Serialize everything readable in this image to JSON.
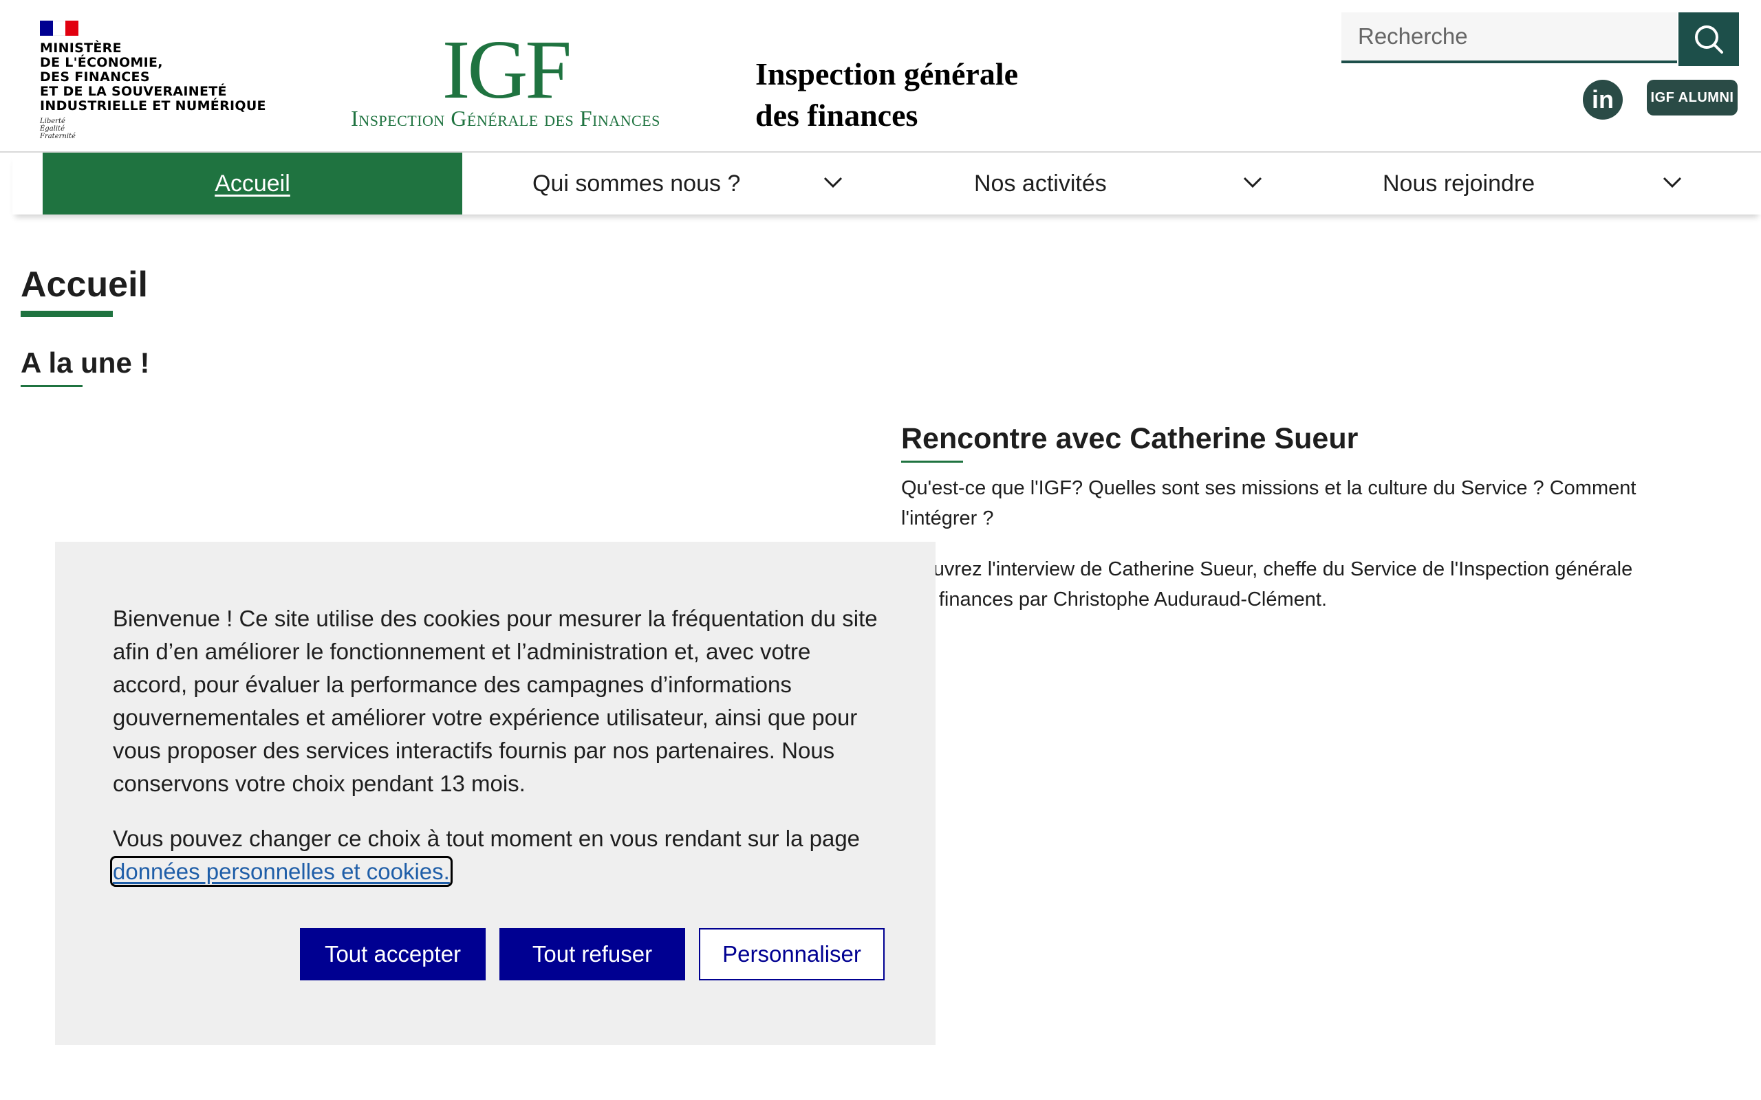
{
  "header": {
    "ministry_lines": [
      "MINISTÈRE",
      "DE L'ÉCONOMIE,",
      "DES FINANCES",
      "ET DE LA SOUVERAINETÉ",
      "INDUSTRIELLE ET NUMÉRIQUE"
    ],
    "motto_lines": [
      "Liberté",
      "Égalité",
      "Fraternité"
    ],
    "logo_text": "IGF",
    "logo_subtitle": "Inspection Générale des Finances",
    "site_title_lines": [
      "Inspection générale",
      "des finances"
    ],
    "search_placeholder": "Recherche",
    "linkedin_label": "in",
    "alumni_label": "IGF ALUMNI"
  },
  "nav": {
    "items": [
      {
        "label": "Accueil",
        "active": true
      },
      {
        "label": "Qui sommes nous ?",
        "has_dropdown": true
      },
      {
        "label": "Nos activités",
        "has_dropdown": true
      },
      {
        "label": "Nous rejoindre",
        "has_dropdown": true
      }
    ]
  },
  "main": {
    "page_title": "Accueil",
    "section_title": "A la une !",
    "article": {
      "title": "Rencontre avec Catherine Sueur",
      "paragraphs": [
        "Qu'est-ce que l'IGF? Quelles sont ses missions et la culture du Service ? Comment l'intégrer ?",
        "écouvrez l'interview de Catherine Sueur, cheffe du Service de l'Inspection générale des finances par Christophe Auduraud-Clément."
      ]
    }
  },
  "cookie_banner": {
    "text": "Bienvenue ! Ce site utilise des cookies pour mesurer la fréquentation du site afin d’en améliorer le fonctionnement et l’administration et, avec votre accord, pour évaluer la performance des campagnes d’informations gouvernementales et améliorer votre expérience utilisateur, ainsi que pour vous proposer des services interactifs fournis par nos partenaires. Nous conservons votre choix pendant 13 mois.",
    "change_text": "Vous pouvez changer ce choix à tout moment en vous rendant sur la page ",
    "link_text": "données personnelles et cookies.",
    "accept_label": "Tout accepter",
    "refuse_label": "Tout refuser",
    "customize_label": "Personnaliser"
  },
  "colors": {
    "brand_green": "#1f7340",
    "dark_teal": "#1d4f4a",
    "button_blue": "#000091",
    "banner_bg": "#efefef",
    "flag_blue": "#000091",
    "flag_red": "#e1000f"
  },
  "icons": [
    "marianne-flag-icon",
    "search-icon",
    "linkedin-icon",
    "chevron-down-icon"
  ]
}
